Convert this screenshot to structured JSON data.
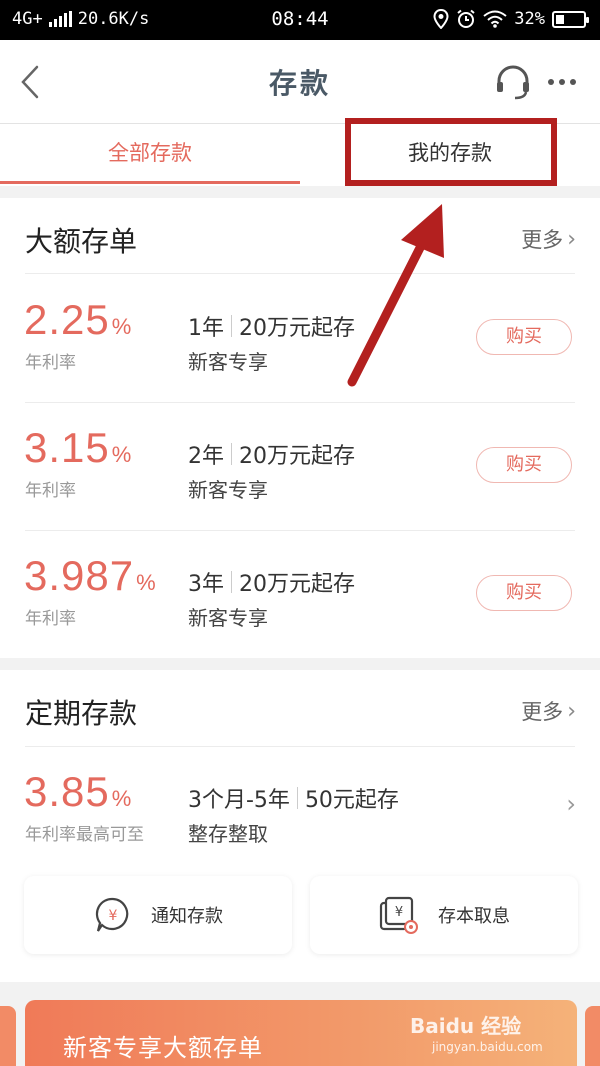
{
  "status_bar": {
    "network": "4G+",
    "speed": "20.6K/s",
    "time": "08:44",
    "battery": "32%",
    "battery_level": 0.32
  },
  "nav": {
    "title": "存款"
  },
  "tabs": [
    {
      "label": "全部存款",
      "active": true
    },
    {
      "label": "我的存款",
      "active": false
    }
  ],
  "large_deposit": {
    "title": "大额存单",
    "more_label": "更多",
    "items": [
      {
        "rate": "2.25",
        "unit": "%",
        "rate_label": "年利率",
        "term": "1年",
        "min": "20万元起存",
        "tag": "新客专享",
        "button": "购买"
      },
      {
        "rate": "3.15",
        "unit": "%",
        "rate_label": "年利率",
        "term": "2年",
        "min": "20万元起存",
        "tag": "新客专享",
        "button": "购买"
      },
      {
        "rate": "3.987",
        "unit": "%",
        "rate_label": "年利率",
        "term": "3年",
        "min": "20万元起存",
        "tag": "新客专享",
        "button": "购买"
      }
    ]
  },
  "fixed_deposit": {
    "title": "定期存款",
    "more_label": "更多",
    "item": {
      "rate": "3.85",
      "unit": "%",
      "rate_label": "年利率最高可至",
      "term": "3个月-5年",
      "min": "50元起存",
      "tag": "整存整取"
    }
  },
  "quick_actions": [
    {
      "label": "通知存款",
      "icon": "notice-deposit-icon"
    },
    {
      "label": "存本取息",
      "icon": "interest-withdraw-icon"
    }
  ],
  "banner": {
    "title": "新客专享大额存单"
  },
  "watermark": {
    "text": "Baidu 经验",
    "sub": "jingyan.baidu.com"
  },
  "colors": {
    "accent": "#e46a5e",
    "annotation": "#b3201f"
  }
}
